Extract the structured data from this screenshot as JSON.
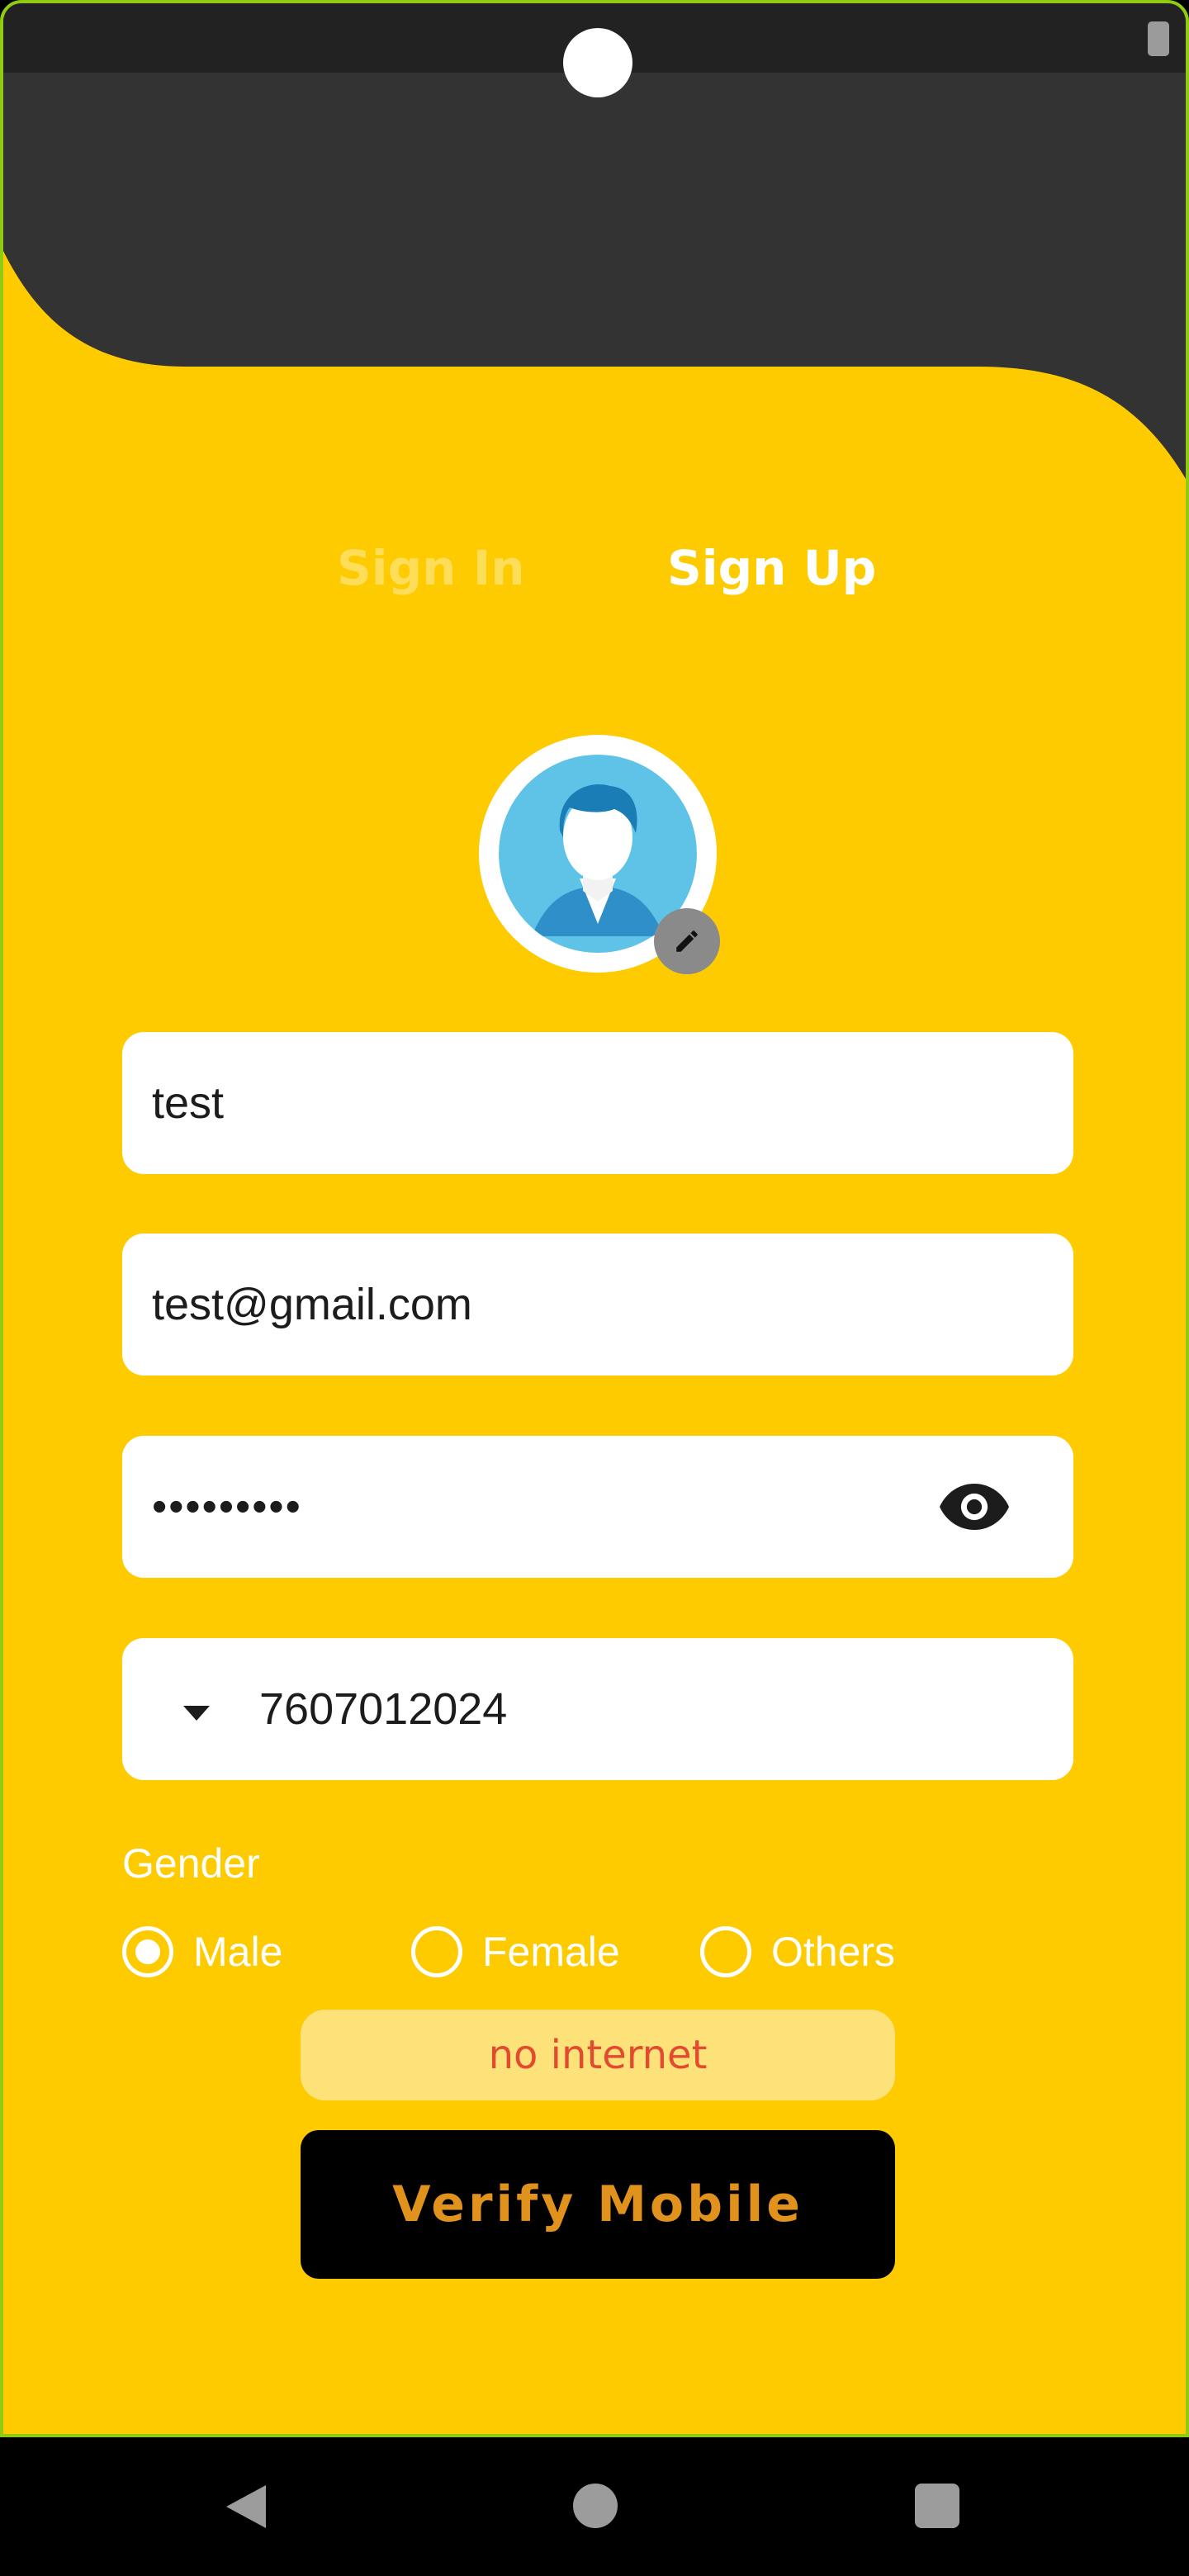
{
  "tabs": {
    "signin": "Sign In",
    "signup": "Sign Up"
  },
  "form": {
    "name_value": "test",
    "email_value": "test@gmail.com",
    "password_value": "•••••••••",
    "phone_value": "7607012024"
  },
  "gender": {
    "label": "Gender",
    "options": [
      {
        "label": "Male",
        "selected": true
      },
      {
        "label": "Female",
        "selected": false
      },
      {
        "label": "Others",
        "selected": false
      }
    ]
  },
  "toast": "no internet",
  "verify_button": "Verify Mobile",
  "colors": {
    "background": "#FDCB00",
    "header": "#333333",
    "toast_bg": "#FDE27A",
    "toast_text": "#E24B30",
    "button_bg": "#000000",
    "button_text": "#E0921C"
  },
  "icons": [
    "avatar-icon",
    "pencil-icon",
    "eye-icon",
    "dropdown-arrow-icon",
    "back-icon",
    "home-icon",
    "recents-icon",
    "battery-icon"
  ]
}
